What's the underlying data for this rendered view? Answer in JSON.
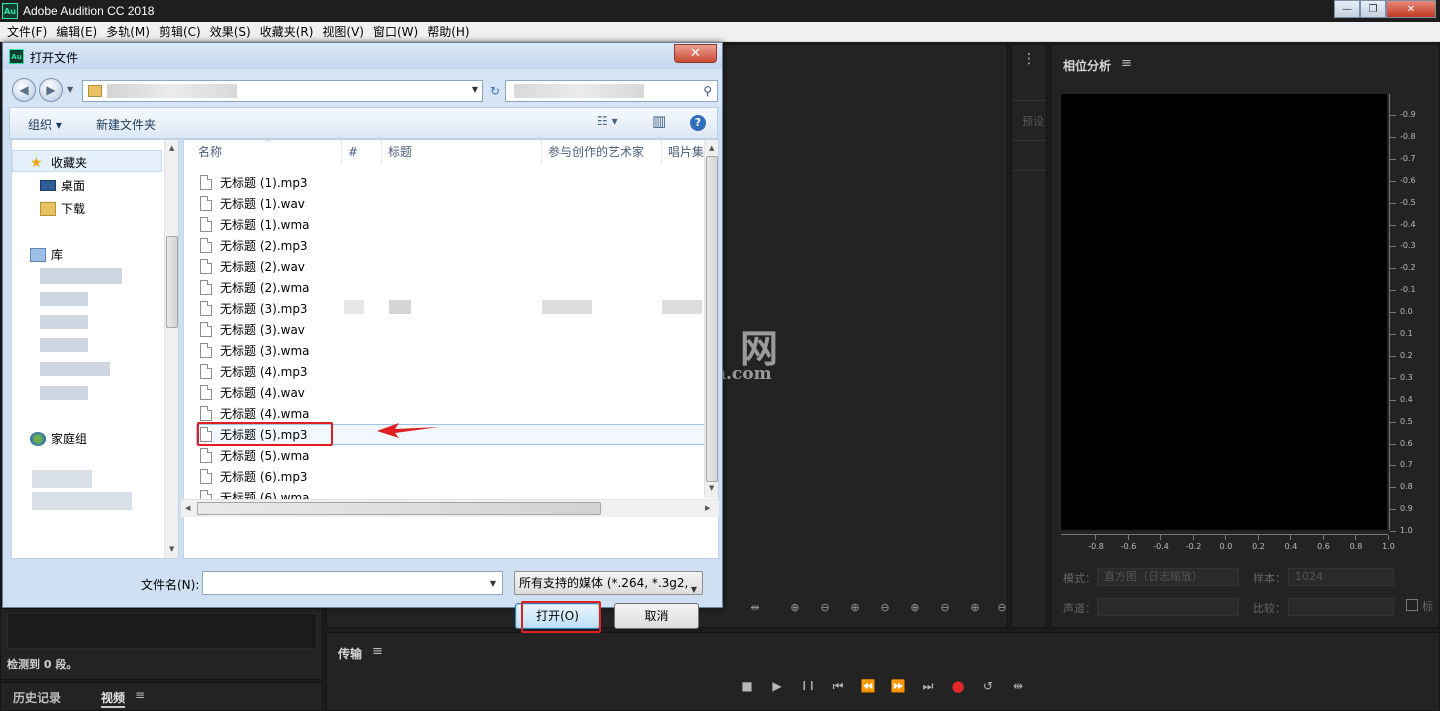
{
  "app": {
    "logo": "Au",
    "title": "Adobe Audition CC 2018",
    "window_controls": [
      "—",
      "❐",
      "✕"
    ]
  },
  "menu": [
    "文件(F)",
    "编辑(E)",
    "多轨(M)",
    "剪辑(C)",
    "效果(S)",
    "收藏夹(R)",
    "视图(V)",
    "窗口(W)",
    "帮助(H)"
  ],
  "phase_panel": {
    "title": "相位分析",
    "menu_icon": "≡",
    "y_ticks": [
      "-0.9",
      "-0.8",
      "-0.7",
      "-0.6",
      "-0.5",
      "-0.4",
      "-0.3",
      "-0.2",
      "-0.1",
      "0.0",
      "0.1",
      "0.2",
      "0.3",
      "0.4",
      "0.5",
      "0.6",
      "0.7",
      "0.8",
      "0.9",
      "1.0"
    ],
    "x_ticks": [
      "-0.8",
      "-0.6",
      "-0.4",
      "-0.2",
      "0.0",
      "0.2",
      "0.4",
      "0.6",
      "0.8",
      "1.0"
    ],
    "mode_label": "模式：",
    "mode_value": "直方图（日志缩放）",
    "sample_label": "样本：",
    "sample_value": "1024",
    "channel_label": "声道：",
    "channel_value": "",
    "compare_label": "比较：",
    "compare_value": "",
    "extra_check_label": "标"
  },
  "side_strip": {
    "dots": "⋮",
    "preset_label": "预设"
  },
  "left_panel": {
    "status": "检测到 0 段。",
    "tabs": [
      {
        "label": "历史记录"
      },
      {
        "label": "视频"
      }
    ],
    "menu_icon": "≡"
  },
  "transport": {
    "title": "传输",
    "menu_icon": "≡",
    "buttons": [
      "■",
      "▶",
      "❙❙",
      "⏮",
      "⏪",
      "⏩",
      "⏭",
      "●",
      "↺",
      "⇹"
    ]
  },
  "editor_toolbar": {
    "zoom_icons": [
      "⊕",
      "⊖",
      "⊕",
      "⊖",
      "⊕",
      "⊖",
      "⊕",
      "⊖"
    ]
  },
  "watermark": {
    "text": "网",
    "domain": "m.com"
  },
  "dialog": {
    "logo": "Au",
    "title": "打开文件",
    "close": "✕",
    "toolbar": {
      "organize": "组织 ▾",
      "new_folder": "新建文件夹",
      "view_icon": "☷ ▾",
      "pane_icon": "▥",
      "help_icon": "?"
    },
    "nav": {
      "favorites": "收藏夹",
      "desktop": "桌面",
      "downloads": "下载",
      "libraries": "库",
      "homegroup": "家庭组"
    },
    "columns": [
      "名称",
      "#",
      "标题",
      "参与创作的艺术家",
      "唱片集"
    ],
    "files": [
      "无标题 (1).mp3",
      "无标题 (1).wav",
      "无标题 (1).wma",
      "无标题 (2).mp3",
      "无标题 (2).wav",
      "无标题 (2).wma",
      "无标题 (3).mp3",
      "无标题 (3).wav",
      "无标题 (3).wma",
      "无标题 (4).mp3",
      "无标题 (4).wav",
      "无标题 (4).wma",
      "无标题 (5).mp3",
      "无标题 (5).wma",
      "无标题 (6).mp3",
      "无标题 (6).wma"
    ],
    "selected_file": "无标题 (5).mp3",
    "filename_label": "文件名(N):",
    "filename_value": "",
    "filetype_value": "所有支持的媒体 (*.264, *.3g2,",
    "open_button": "打开(O)",
    "cancel_button": "取消",
    "colors": {
      "highlight": "#e02020",
      "panel_bg": "#cfe0f3"
    }
  }
}
